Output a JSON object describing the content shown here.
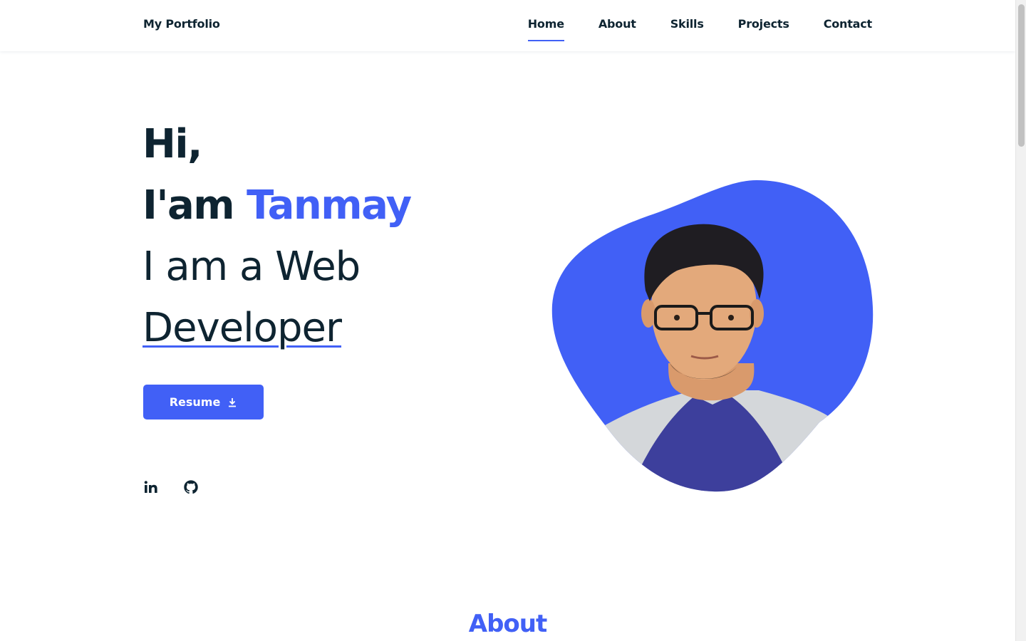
{
  "header": {
    "logo": "My Portfolio",
    "nav": [
      {
        "label": "Home",
        "active": true
      },
      {
        "label": "About",
        "active": false
      },
      {
        "label": "Skills",
        "active": false
      },
      {
        "label": "Projects",
        "active": false
      },
      {
        "label": "Contact",
        "active": false
      }
    ]
  },
  "hero": {
    "greeting": "Hi,",
    "intro_prefix": "I'am ",
    "name": "Tanmay",
    "role_line1": "I am a Web",
    "role_line2": "Developer",
    "resume_label": "Resume",
    "resume_icon": "download-icon",
    "socials": [
      {
        "icon": "linkedin-icon"
      },
      {
        "icon": "github-icon"
      }
    ],
    "image": "profile-photo"
  },
  "about": {
    "title": "About"
  },
  "colors": {
    "accent": "#4160f6",
    "text": "#0e2431",
    "background": "#ffffff"
  }
}
